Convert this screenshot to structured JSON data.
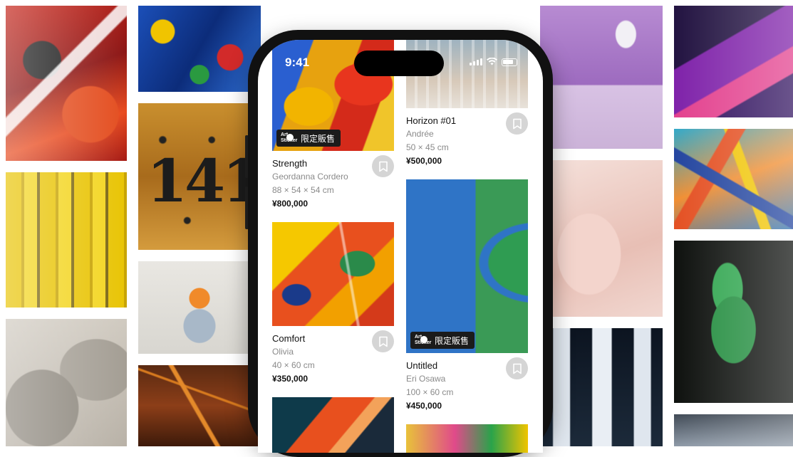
{
  "status_bar": {
    "time": "9:41"
  },
  "badge": {
    "logo_line1": "Art",
    "logo_line2": "Sticker",
    "label": "限定販售"
  },
  "artworks": [
    {
      "title": "Strength",
      "artist": "Geordanna Cordero",
      "size": "88 × 54 × 54 cm",
      "price": "¥800,000",
      "badge": true
    },
    {
      "title": "Comfort",
      "artist": "Olivia",
      "size": "40 × 60 cm",
      "price": "¥350,000",
      "badge": false
    },
    {
      "title": "Horizon #01",
      "artist": "Andrée",
      "size": "50 × 45 cm",
      "price": "¥500,000",
      "badge": false
    },
    {
      "title": "Untitled",
      "artist": "Eri Osawa",
      "size": "100 × 60 cm",
      "price": "¥450,000",
      "badge": true
    }
  ],
  "background_wall": {
    "tile_number_text": "141"
  },
  "icons": {
    "bookmark": "bookmark-icon",
    "signal": "signal-icon",
    "wifi": "wifi-icon",
    "battery": "battery-icon"
  },
  "colors": {
    "badge_bg": "#1b1b1b",
    "bookmark_bg": "#d5d5d5",
    "muted_text": "#8a8a8a"
  }
}
